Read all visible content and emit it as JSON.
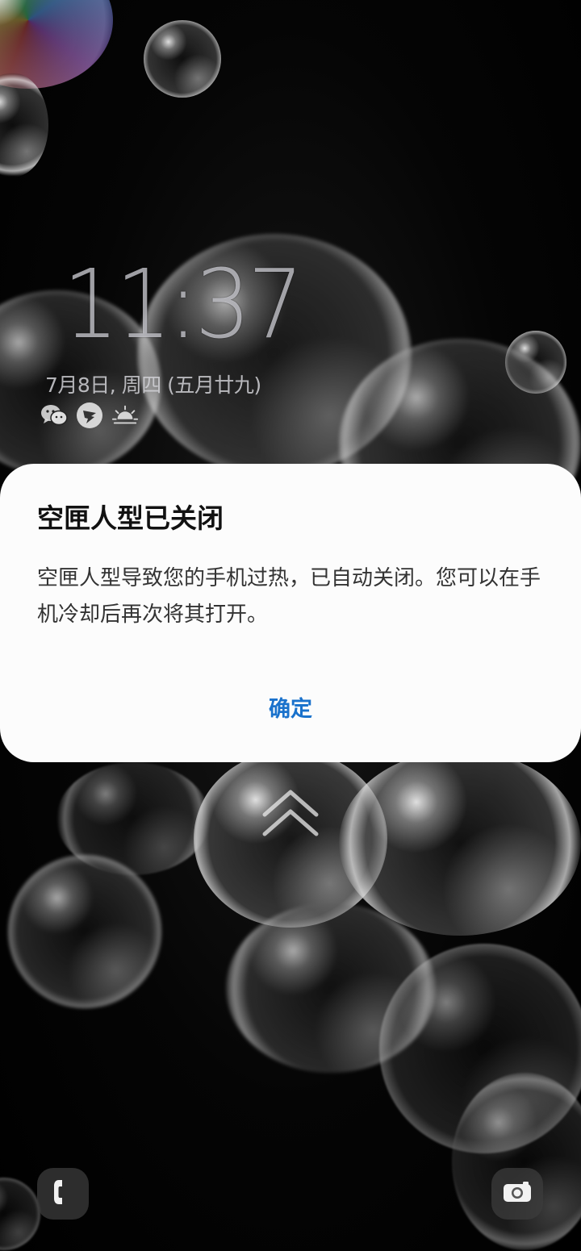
{
  "lock_screen": {
    "time": "11:37",
    "date": "7月8日, 周四 (五月廿九)",
    "notification_icons": [
      "wechat-icon",
      "dingtalk-icon",
      "weather-sunrise-icon"
    ]
  },
  "dialog": {
    "title": "空匣人型已关闭",
    "message": "空匣人型导致您的手机过热，已自动关闭。您可以在手机冷却后再次将其打开。",
    "confirm_label": "确定",
    "accent_color": "#1a72cc"
  },
  "shortcuts": {
    "left": "phone-icon",
    "right": "camera-icon"
  },
  "swipe_hint": "chevron-up-icon"
}
